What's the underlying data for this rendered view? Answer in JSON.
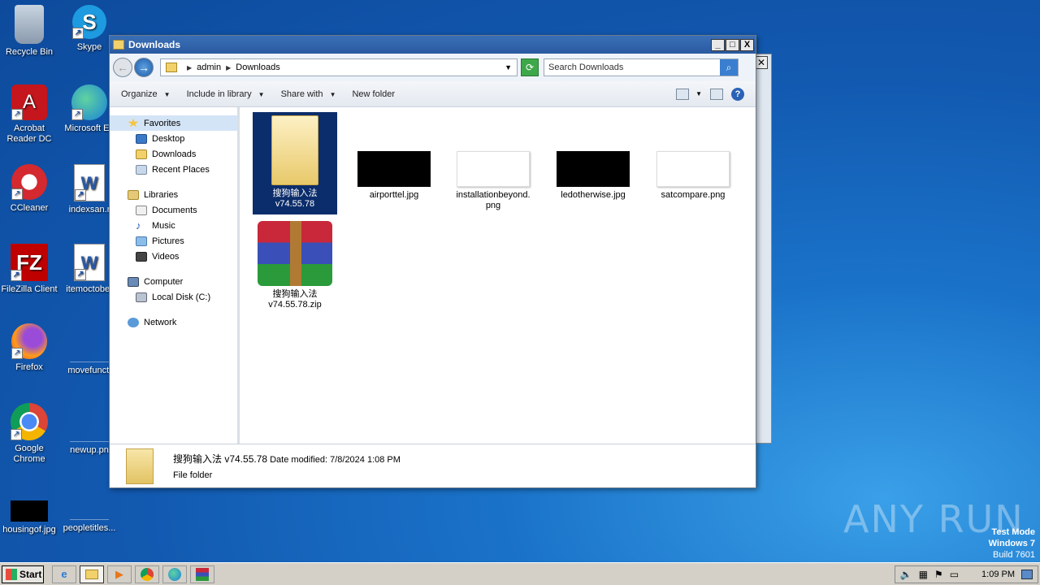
{
  "desktop": {
    "icons": [
      {
        "label": "Recycle Bin"
      },
      {
        "label": "Skype"
      },
      {
        "label": "Acrobat Reader DC"
      },
      {
        "label": "Microsoft Ed"
      },
      {
        "label": "CCleaner"
      },
      {
        "label": "indexsan.r"
      },
      {
        "label": "FileZilla Client"
      },
      {
        "label": "itemoctober"
      },
      {
        "label": "Firefox"
      },
      {
        "label": "movefuncti"
      },
      {
        "label": "Google Chrome"
      },
      {
        "label": "newup.pn"
      },
      {
        "label": "housingof.jpg"
      },
      {
        "label": "peopletitles..."
      }
    ]
  },
  "watermark": {
    "text": "ANY RUN",
    "test_mode": "Test Mode",
    "os": "Windows 7",
    "build": "Build 7601"
  },
  "window": {
    "title": "Downloads",
    "minimize": "_",
    "maximize": "□",
    "close": "X",
    "address": {
      "crumb1": "admin",
      "crumb2": "Downloads"
    },
    "search_placeholder": "Search Downloads",
    "toolbar": {
      "organize": "Organize",
      "include_in_library": "Include in library",
      "share_with": "Share with",
      "new_folder": "New folder",
      "help": "?"
    },
    "nav": {
      "favorites": "Favorites",
      "desktop": "Desktop",
      "downloads": "Downloads",
      "recent_places": "Recent Places",
      "libraries": "Libraries",
      "documents": "Documents",
      "music": "Music",
      "pictures": "Pictures",
      "videos": "Videos",
      "computer": "Computer",
      "local_disk": "Local Disk (C:)",
      "network": "Network"
    },
    "files": [
      {
        "name": "搜狗输入法 v74.55.78",
        "type": "folder"
      },
      {
        "name": "airporttel.jpg",
        "type": "image"
      },
      {
        "name": "installationbeyond.png",
        "type": "image"
      },
      {
        "name": "ledotherwise.jpg",
        "type": "image"
      },
      {
        "name": "satcompare.png",
        "type": "image"
      },
      {
        "name": "搜狗输入法 v74.55.78.zip",
        "type": "archive"
      }
    ],
    "details": {
      "name": "搜狗输入法 v74.55.78",
      "date_modified": "Date modified: 7/8/2024 1:08 PM",
      "type": "File folder"
    }
  },
  "taskbar": {
    "start": "Start",
    "clock": "1:09 PM"
  }
}
